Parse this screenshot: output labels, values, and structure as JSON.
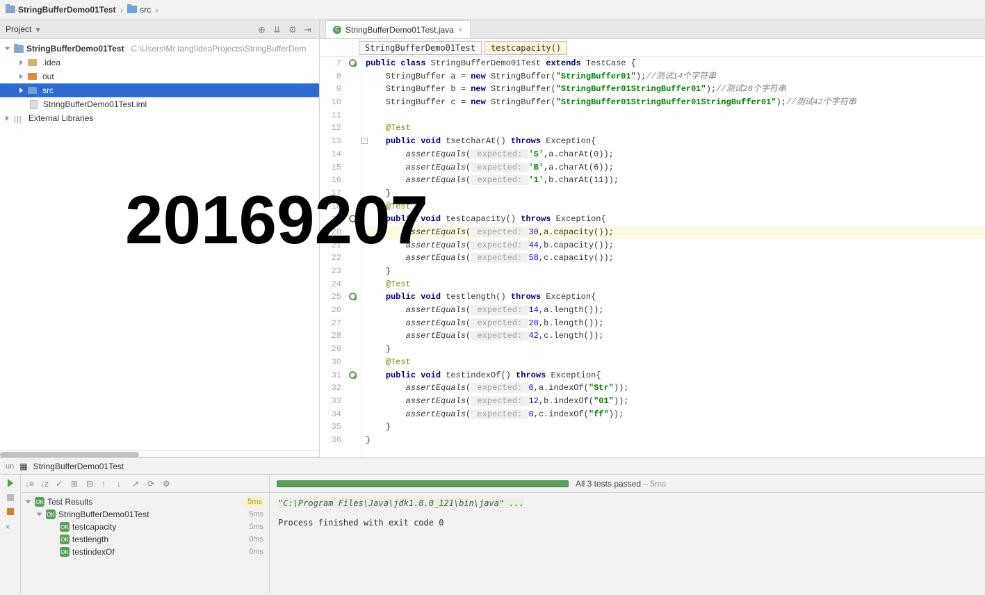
{
  "breadcrumb": {
    "root": "StringBufferDemo01Test",
    "child": "src"
  },
  "project_panel": {
    "title": "Project",
    "root_name": "StringBufferDemo01Test",
    "root_path": "C:\\Users\\Mr.tang\\IdeaProjects\\StringBufferDem",
    "nodes": {
      "idea": ".idea",
      "out": "out",
      "src": "src",
      "iml": "StringBufferDemo01Test.iml",
      "ext_lib": "External Libraries"
    }
  },
  "editor": {
    "tab": "StringBufferDemo01Test.java",
    "bc1": "StringBufferDemo01Test",
    "bc2": "testcapacity()",
    "line_start": 7,
    "line_end": 36
  },
  "code": {
    "l7_pre": "public class ",
    "l7_cls": "StringBufferDemo01Test",
    "l7_ext": " extends ",
    "l7_sup": "TestCase {",
    "l8": "    StringBuffer ",
    "l8v": "a",
    "l8m": " = ",
    "l8n": "new ",
    "l8c": "StringBuffer(",
    "l8s": "\"StringBuffer01\"",
    "l8e": ");",
    "l8cm": "//测试14个字符串",
    "l9": "    StringBuffer ",
    "l9v": "b",
    "l9s": "\"StringBuffer01StringBuffer01\"",
    "l9cm": "//测试28个字符串",
    "l10": "    StringBuffer ",
    "l10v": "c",
    "l10s": "\"StringBuffer01StringBuffer01StringBuffer01\"",
    "l10cm": "//测试42个字符串",
    "ann": "@Test",
    "l13_m": "tsetcharAt",
    "thr": " throws ",
    "exc": "Exception{",
    "ae": "assertEquals",
    "exp": " expected: ",
    "l14_val": "'S'",
    "l14_rhs": "a.charAt(0));",
    "l15_val": "'B'",
    "l15_rhs": "a.charAt(6));",
    "l16_val": "'1'",
    "l16_rhs": "b.charAt(11));",
    "l19_m": "testcapacity",
    "l20_val": "30",
    "l20_rhs": "a.capacity());",
    "l21_val": "44",
    "l21_rhs": "b.capacity());",
    "l22_val": "58",
    "l22_rhs": "c.capacity());",
    "l25_m": "testlength",
    "l26_val": "14",
    "l26_rhs": "a.length());",
    "l27_val": "28",
    "l27_rhs": "b.length());",
    "l28_val": "42",
    "l28_rhs": "c.length());",
    "l31_m": "testindexOf",
    "l32_val": "0",
    "l32_rhs": "a.indexOf(",
    "l32_str": "\"Str\"",
    "l32_end": "));",
    "l33_val": "12",
    "l33_rhs": "b.indexOf(",
    "l33_str": "\"01\"",
    "l33_end": "));",
    "l34_val": "8",
    "l34_rhs": "c.indexOf(",
    "l34_str": "\"ff\"",
    "l34_end": "));",
    "pv": "public void ",
    "brace_close": "}"
  },
  "run": {
    "tab": "StringBufferDemo01Test",
    "results_label": "Test Results",
    "suite": "StringBufferDemo01Test",
    "t1": "testcapacity",
    "t1_time": "5ms",
    "t2": "testlength",
    "t2_time": "0ms",
    "t3": "testindexOf",
    "t3_time": "0ms",
    "suite_time": "5ms",
    "root_time": "5ms",
    "pass_text": "All 3 tests passed",
    "pass_time": " – 5ms",
    "console_cmd": "\"C:\\Program Files\\Java\\jdk1.8.0_121\\bin\\java\" ...",
    "console_exit": "Process finished with exit code 0"
  },
  "watermark": "20169207"
}
